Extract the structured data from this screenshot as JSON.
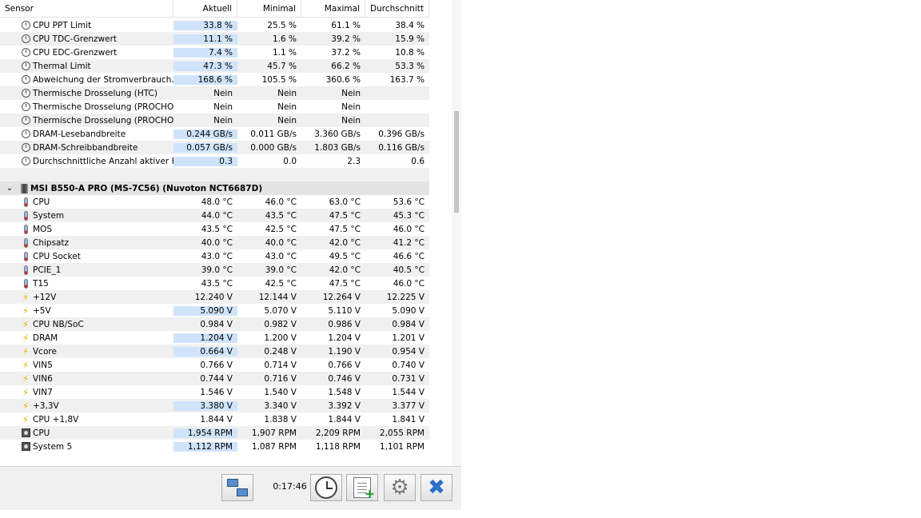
{
  "header": {
    "sensor": "Sensor",
    "current": "Aktuell",
    "min": "Minimal",
    "max": "Maximal",
    "avg": "Durchschnitt"
  },
  "cpu_rows": [
    {
      "icon": "clock-icon",
      "label": "CPU PPT Limit",
      "cur": "33.8 %",
      "min": "25.5 %",
      "max": "61.1 %",
      "avg": "38.4 %",
      "hl": true
    },
    {
      "icon": "clock-icon",
      "label": "CPU TDC-Grenzwert",
      "cur": "11.1 %",
      "min": "1.6 %",
      "max": "39.2 %",
      "avg": "15.9 %",
      "hl": true
    },
    {
      "icon": "clock-icon",
      "label": "CPU EDC-Grenzwert",
      "cur": "7.4 %",
      "min": "1.1 %",
      "max": "37.2 %",
      "avg": "10.8 %",
      "hl": true
    },
    {
      "icon": "clock-icon",
      "label": "Thermal Limit",
      "cur": "47.3 %",
      "min": "45.7 %",
      "max": "66.2 %",
      "avg": "53.3 %",
      "hl": true
    },
    {
      "icon": "clock-icon",
      "label": "Abweichung der Stromverbrauch…",
      "cur": "168.6 %",
      "min": "105.5 %",
      "max": "360.6 %",
      "avg": "163.7 %",
      "hl": true
    },
    {
      "icon": "clock-icon",
      "label": "Thermische Drosselung (HTC)",
      "cur": "Nein",
      "min": "Nein",
      "max": "Nein",
      "avg": "",
      "hl": false
    },
    {
      "icon": "clock-icon",
      "label": "Thermische Drosselung (PROCHO…",
      "cur": "Nein",
      "min": "Nein",
      "max": "Nein",
      "avg": "",
      "hl": false
    },
    {
      "icon": "clock-icon",
      "label": "Thermische Drosselung (PROCHO…",
      "cur": "Nein",
      "min": "Nein",
      "max": "Nein",
      "avg": "",
      "hl": false
    },
    {
      "icon": "clock-icon",
      "label": "DRAM-Lesebandbreite",
      "cur": "0.244 GB/s",
      "min": "0.011 GB/s",
      "max": "3.360 GB/s",
      "avg": "0.396 GB/s",
      "hl": true
    },
    {
      "icon": "clock-icon",
      "label": "DRAM-Schreibbandbreite",
      "cur": "0.057 GB/s",
      "min": "0.000 GB/s",
      "max": "1.803 GB/s",
      "avg": "0.116 GB/s",
      "hl": true
    },
    {
      "icon": "clock-icon",
      "label": "Durchschnittliche Anzahl aktiver K…",
      "cur": "0.3",
      "min": "0.0",
      "max": "2.3",
      "avg": "0.6",
      "hl": true
    }
  ],
  "group": {
    "chevron": "⌄",
    "title": "MSI B550-A PRO (MS-7C56) (Nuvoton NCT6687D)"
  },
  "board_rows": [
    {
      "icon": "thermometer-icon",
      "label": "CPU",
      "cur": "48.0 °C",
      "min": "46.0 °C",
      "max": "63.0 °C",
      "avg": "53.6 °C",
      "hl": false
    },
    {
      "icon": "thermometer-icon",
      "label": "System",
      "cur": "44.0 °C",
      "min": "43.5 °C",
      "max": "47.5 °C",
      "avg": "45.3 °C",
      "hl": false
    },
    {
      "icon": "thermometer-icon",
      "label": "MOS",
      "cur": "43.5 °C",
      "min": "42.5 °C",
      "max": "47.5 °C",
      "avg": "46.0 °C",
      "hl": false
    },
    {
      "icon": "thermometer-icon",
      "label": "Chipsatz",
      "cur": "40.0 °C",
      "min": "40.0 °C",
      "max": "42.0 °C",
      "avg": "41.2 °C",
      "hl": false
    },
    {
      "icon": "thermometer-icon",
      "label": "CPU Socket",
      "cur": "43.0 °C",
      "min": "43.0 °C",
      "max": "49.5 °C",
      "avg": "46.6 °C",
      "hl": false
    },
    {
      "icon": "thermometer-icon",
      "label": "PCIE_1",
      "cur": "39.0 °C",
      "min": "39.0 °C",
      "max": "42.0 °C",
      "avg": "40.5 °C",
      "hl": false
    },
    {
      "icon": "thermometer-icon",
      "label": "T15",
      "cur": "43.5 °C",
      "min": "42.5 °C",
      "max": "47.5 °C",
      "avg": "46.0 °C",
      "hl": false
    },
    {
      "icon": "voltage-icon",
      "label": "+12V",
      "cur": "12.240 V",
      "min": "12.144 V",
      "max": "12.264 V",
      "avg": "12.225 V",
      "hl": false
    },
    {
      "icon": "voltage-icon",
      "label": "+5V",
      "cur": "5.090 V",
      "min": "5.070 V",
      "max": "5.110 V",
      "avg": "5.090 V",
      "hl": true
    },
    {
      "icon": "voltage-icon",
      "label": "CPU NB/SoC",
      "cur": "0.984 V",
      "min": "0.982 V",
      "max": "0.986 V",
      "avg": "0.984 V",
      "hl": false
    },
    {
      "icon": "voltage-icon",
      "label": "DRAM",
      "cur": "1.204 V",
      "min": "1.200 V",
      "max": "1.204 V",
      "avg": "1.201 V",
      "hl": true
    },
    {
      "icon": "voltage-icon",
      "label": "Vcore",
      "cur": "0.664 V",
      "min": "0.248 V",
      "max": "1.190 V",
      "avg": "0.954 V",
      "hl": true
    },
    {
      "icon": "voltage-icon",
      "label": "VIN5",
      "cur": "0.766 V",
      "min": "0.714 V",
      "max": "0.766 V",
      "avg": "0.740 V",
      "hl": false
    },
    {
      "icon": "voltage-icon",
      "label": "VIN6",
      "cur": "0.744 V",
      "min": "0.716 V",
      "max": "0.746 V",
      "avg": "0.731 V",
      "hl": false
    },
    {
      "icon": "voltage-icon",
      "label": "VIN7",
      "cur": "1.546 V",
      "min": "1.540 V",
      "max": "1.548 V",
      "avg": "1.544 V",
      "hl": false
    },
    {
      "icon": "voltage-icon",
      "label": "+3,3V",
      "cur": "3.380 V",
      "min": "3.340 V",
      "max": "3.392 V",
      "avg": "3.377 V",
      "hl": true
    },
    {
      "icon": "voltage-icon",
      "label": "CPU +1,8V",
      "cur": "1.844 V",
      "min": "1.838 V",
      "max": "1.844 V",
      "avg": "1.841 V",
      "hl": false
    },
    {
      "icon": "fan-icon",
      "label": "CPU",
      "cur": "1,954 RPM",
      "min": "1,907 RPM",
      "max": "2,209 RPM",
      "avg": "2,055 RPM",
      "hl": true
    },
    {
      "icon": "fan-icon",
      "label": "System 5",
      "cur": "1,112 RPM",
      "min": "1,087 RPM",
      "max": "1,118 RPM",
      "avg": "1,101 RPM",
      "hl": true
    }
  ],
  "toolbar": {
    "timer": "0:17:46",
    "network_icon": "network-icon",
    "clock_icon": "clock-icon",
    "report_icon": "report-add-icon",
    "settings_icon": "gear-icon",
    "close_icon": "close-icon"
  }
}
